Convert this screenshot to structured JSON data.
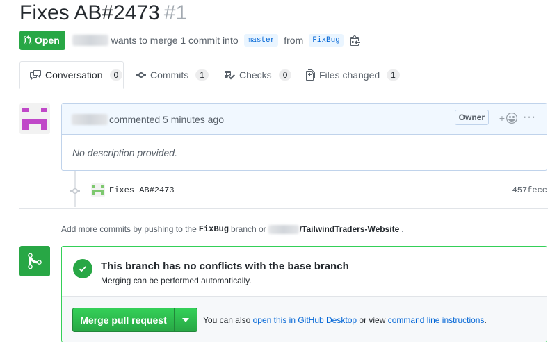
{
  "pr": {
    "title": "Fixes AB#2473",
    "number": "#1",
    "state": "Open",
    "merge_text": "wants to merge 1 commit into",
    "base_branch": "master",
    "from_text": "from",
    "head_branch": "FixBug"
  },
  "tabs": [
    {
      "label": "Conversation",
      "count": "0"
    },
    {
      "label": "Commits",
      "count": "1"
    },
    {
      "label": "Checks",
      "count": "0"
    },
    {
      "label": "Files changed",
      "count": "1"
    }
  ],
  "comment": {
    "action": "commented 5 minutes ago",
    "badge": "Owner",
    "react": "+",
    "more": "···",
    "body": "No description provided."
  },
  "commit": {
    "message": "Fixes AB#2473",
    "sha": "457fecc"
  },
  "hint": {
    "prefix": "Add more commits by pushing to the",
    "branch": "FixBug",
    "middle": "branch or",
    "repo": "/TailwindTraders-Website",
    "suffix": "."
  },
  "merge": {
    "status_title": "This branch has no conflicts with the base branch",
    "status_sub": "Merging can be performed automatically.",
    "button": "Merge pull request",
    "alt_prefix": "You can also",
    "desktop_link": "open this in GitHub Desktop",
    "alt_middle": "or view",
    "cli_link": "command line instructions",
    "alt_suffix": "."
  },
  "colors": {
    "success": "#28a745",
    "link": "#0366d6",
    "avatar": "#c048c8"
  }
}
